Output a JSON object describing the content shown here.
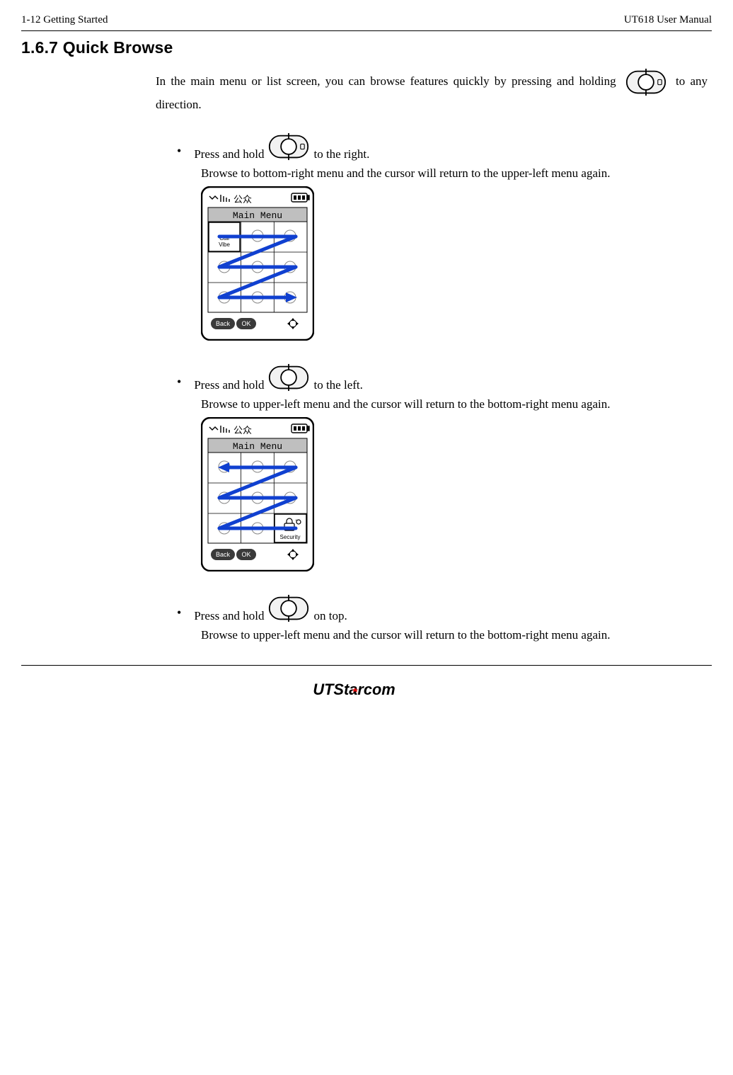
{
  "header": {
    "left": "1-12    Getting Started",
    "right": "UT618 User Manual"
  },
  "section": {
    "number_title": "1.6.7 Quick Browse",
    "intro_before": "In the main menu or list screen, you can browse features quickly by pressing and holding ",
    "intro_after": " to any direction."
  },
  "bullets": [
    {
      "lead": "Press and hold ",
      "trail": " to the right.",
      "desc": "Browse to bottom-right menu and the cursor will return to the upper-left menu again.",
      "figure_title": "Main Menu",
      "figure_tl_label": "Call\nVibe",
      "direction": "right"
    },
    {
      "lead": "Press and hold ",
      "trail": " to the left.",
      "desc": "Browse to upper-left menu and the cursor will return to the bottom-right menu again.",
      "figure_title": "Main Menu",
      "figure_br_label": "Security",
      "direction": "left"
    },
    {
      "lead": "Press and hold ",
      "trail": " on top.",
      "desc": "Browse to upper-left menu and the cursor will return to the bottom-right menu again.",
      "direction": "up"
    }
  ],
  "softkeys": {
    "back": "Back",
    "ok": "OK"
  },
  "footer": {
    "brand_prefix": "UT",
    "brand_rest": "Starcom"
  }
}
